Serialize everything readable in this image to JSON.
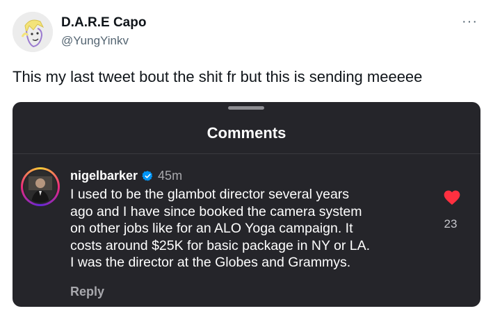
{
  "author": {
    "name": "D.A.R.E Capo",
    "handle": "@YungYinkv",
    "avatar_icon": "cartoon-avatar"
  },
  "more_icon": "more-horizontal-icon",
  "more_label": "···",
  "tweet": {
    "text": "This my last tweet bout the shit fr but this is sending meeeee"
  },
  "embedded_screenshot": {
    "sheet_title": "Comments",
    "comment": {
      "username": "nigelbarker",
      "verified_icon": "verified-badge-icon",
      "time": "45m",
      "lines": [
        "I used to be the glambot director several years",
        "ago and I have since booked the camera system",
        "on other jobs like for an ALO Yoga campaign. It",
        "costs around $25K for basic package in NY or LA.",
        "I was the director at the Globes and Grammys."
      ],
      "reply_label": "Reply",
      "like_icon": "heart-filled-icon",
      "like_count": "23"
    },
    "colors": {
      "background": "#25252a",
      "heart": "#ff3040",
      "verified": "#0095f6"
    }
  }
}
